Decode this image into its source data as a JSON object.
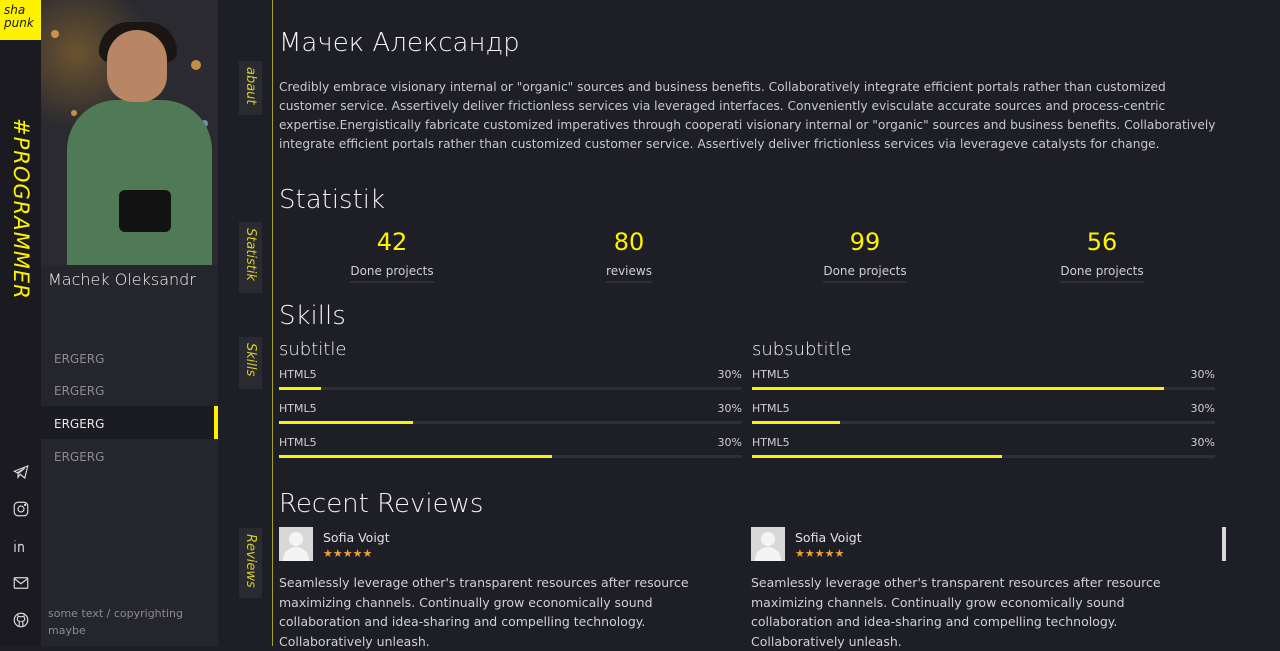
{
  "logo": {
    "line1": "sha",
    "line2": "punk"
  },
  "vertical_title": "#PROGRAMMER",
  "profile": {
    "name": "Machek Oleksandr"
  },
  "menu": [
    {
      "label": "ERGERG",
      "active": false
    },
    {
      "label": "ERGERG",
      "active": false
    },
    {
      "label": "ERGERG",
      "active": true
    },
    {
      "label": "ERGERG",
      "active": false
    }
  ],
  "social": [
    "telegram-icon",
    "instagram-icon",
    "linkedin-icon",
    "mail-icon",
    "github-icon"
  ],
  "copyright": "some text / copyrighting maybe",
  "side_tabs": {
    "about": "abaut",
    "stats": "Statistik",
    "skills": "Skills",
    "reviews": "Reviews"
  },
  "about": {
    "title": "Мачек Александр",
    "text": "Credibly embrace visionary internal or \"organic\" sources and business benefits. Collaboratively integrate efficient portals rather than customized customer service. Assertively deliver frictionless services via leveraged interfaces. Conveniently evisculate accurate sources and process-centric expertise.Energistically fabricate customized imperatives through cooperati visionary internal or \"organic\" sources and business benefits. Collaboratively integrate efficient portals rather than customized customer service. Assertively deliver frictionless services via leverageve catalysts for change."
  },
  "statistik": {
    "title": "Statistik",
    "items": [
      {
        "value": "42",
        "label": "Done projects"
      },
      {
        "value": "80",
        "label": "reviews"
      },
      {
        "value": "99",
        "label": "Done projects"
      },
      {
        "value": "56",
        "label": "Done projects"
      }
    ]
  },
  "skills": {
    "title": "Skills",
    "columns": [
      {
        "subtitle": "subtitle",
        "items": [
          {
            "name": "HTML5",
            "percent_label": "30%",
            "fill": 0.09
          },
          {
            "name": "HTML5",
            "percent_label": "30%",
            "fill": 0.29
          },
          {
            "name": "HTML5",
            "percent_label": "30%",
            "fill": 0.59
          }
        ]
      },
      {
        "subtitle": "subsubtitle",
        "items": [
          {
            "name": "HTML5",
            "percent_label": "30%",
            "fill": 0.89
          },
          {
            "name": "HTML5",
            "percent_label": "30%",
            "fill": 0.19
          },
          {
            "name": "HTML5",
            "percent_label": "30%",
            "fill": 0.54
          }
        ]
      }
    ]
  },
  "reviews": {
    "title": "Recent Reviews",
    "items": [
      {
        "name": "Sofia Voigt",
        "stars": "★★★★★",
        "text": "Seamlessly leverage other's transparent resources after resource maximizing channels. Continually grow economically sound collaboration and idea-sharing and compelling technology. Collaboratively unleash."
      },
      {
        "name": "Sofia Voigt",
        "stars": "★★★★★",
        "text": "Seamlessly leverage other's transparent resources after resource maximizing channels. Continually grow economically sound collaboration and idea-sharing and compelling technology. Collaboratively unleash."
      }
    ]
  },
  "colors": {
    "accent": "#fff200",
    "background": "#1e1e26",
    "panel": "#25252c",
    "star": "#f0a030"
  }
}
